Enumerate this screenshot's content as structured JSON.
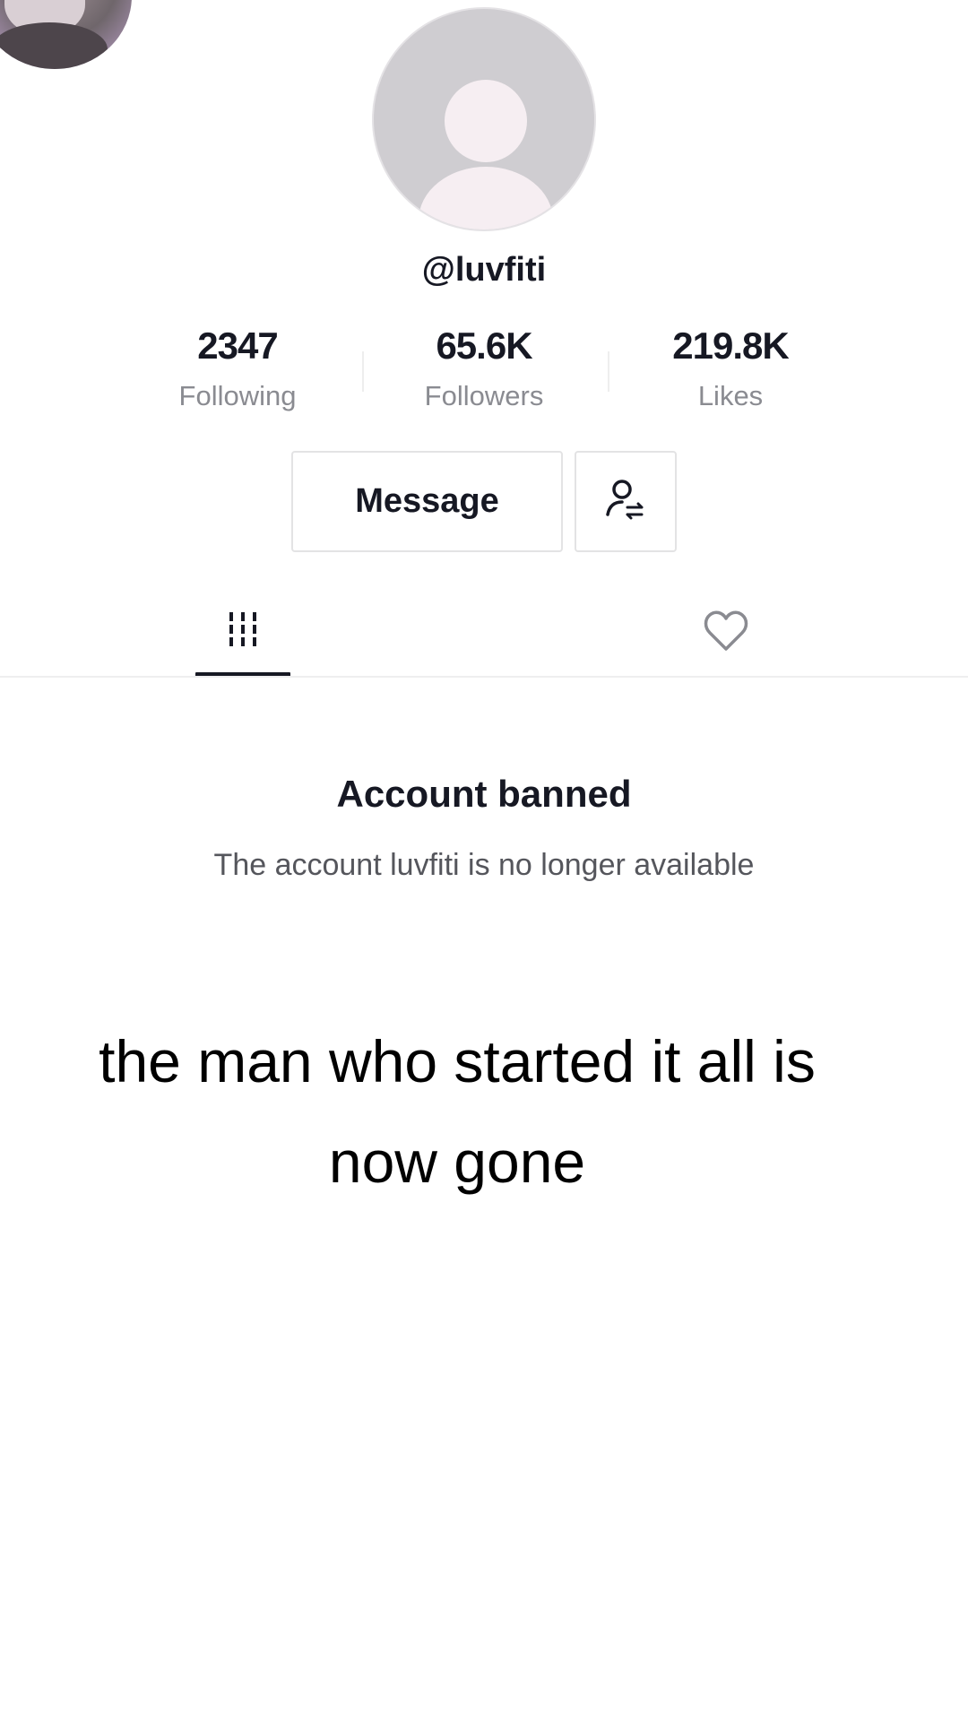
{
  "profile": {
    "username": "@luvfiti",
    "stats": [
      {
        "value": "2347",
        "label": "Following"
      },
      {
        "value": "65.6K",
        "label": "Followers"
      },
      {
        "value": "219.8K",
        "label": "Likes"
      }
    ],
    "message_button": "Message"
  },
  "tabs": {
    "active": "videos",
    "items": [
      {
        "icon": "grid-icon"
      },
      {
        "icon": "heart-outline-icon"
      }
    ]
  },
  "notice": {
    "title": "Account banned",
    "subtitle": "The account luvfiti is no longer available"
  },
  "caption": {
    "line1": "the man who started it all is",
    "line2": "now gone"
  },
  "colors": {
    "text_primary": "#161823",
    "text_secondary": "#8a8b91",
    "border": "#e3e3e4",
    "avatar_placeholder": "#cfcdd1"
  }
}
